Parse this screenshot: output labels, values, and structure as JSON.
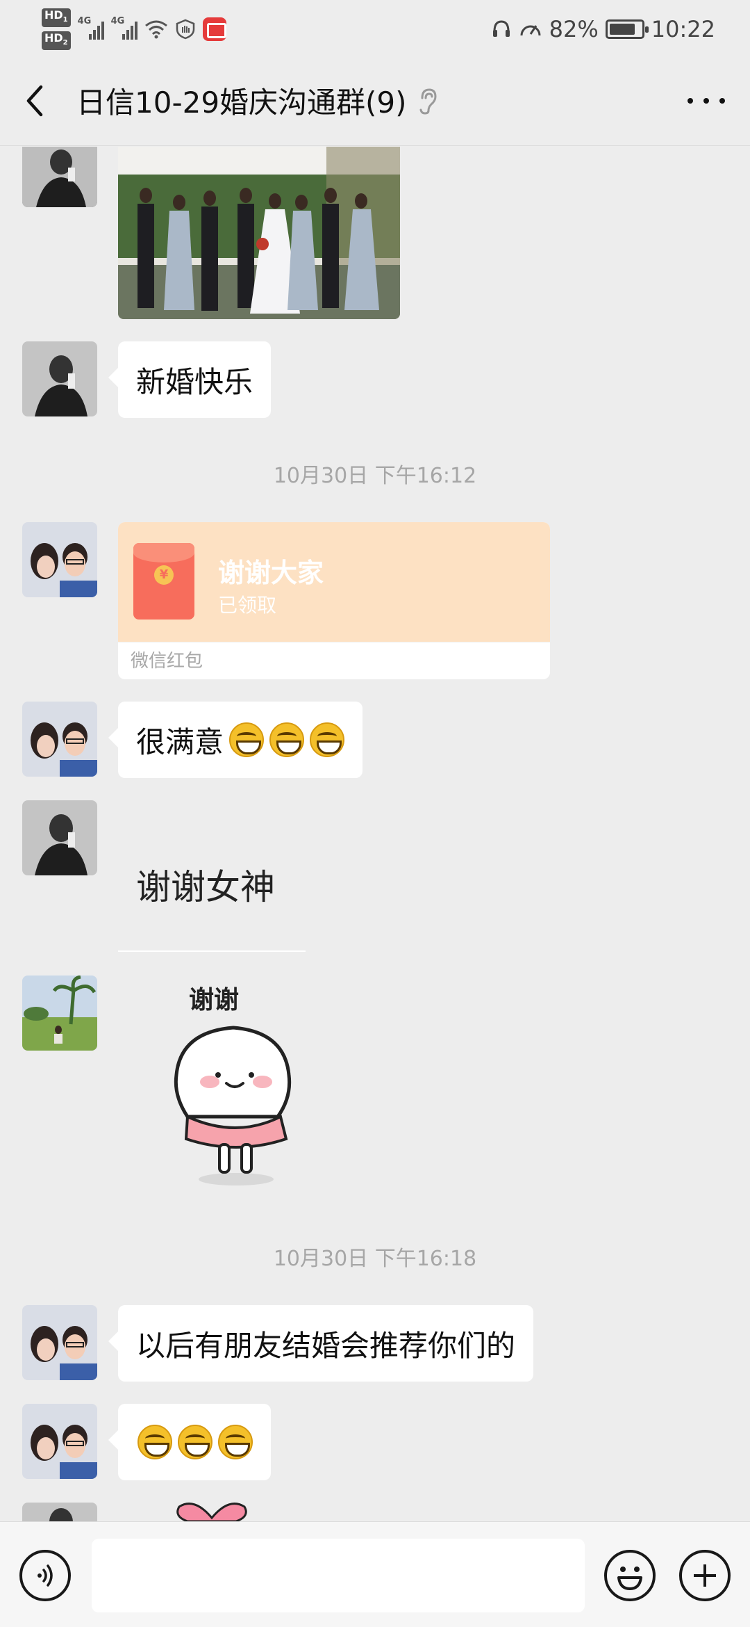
{
  "status_bar": {
    "hd1": "HD",
    "hd1_sub": "1",
    "hd2": "HD",
    "hd2_sub": "2",
    "net1": "4G",
    "net2": "4G",
    "battery_text": "82%",
    "battery_level": 0.82,
    "time": "10:22"
  },
  "header": {
    "title": "日信10-29婚庆沟通群(9)"
  },
  "chat": {
    "messages": [
      {
        "type": "image",
        "label": ""
      },
      {
        "type": "text",
        "text": "新婚快乐"
      },
      {
        "type": "time",
        "text": "10月30日 下午16:12"
      },
      {
        "type": "red_packet",
        "title": "谢谢大家",
        "status": "已领取",
        "footer": "微信红包"
      },
      {
        "type": "text",
        "text": "很满意"
      },
      {
        "type": "text_plain",
        "text": "谢谢女神"
      },
      {
        "type": "sticker",
        "text": "谢谢"
      },
      {
        "type": "time",
        "text": "10月30日 下午16:18"
      },
      {
        "type": "text",
        "text": "以后有朋友结婚会推荐你们的"
      },
      {
        "type": "emoji_only",
        "count": 3
      }
    ]
  },
  "input_bar": {
    "value": "",
    "placeholder": ""
  },
  "colors": {
    "background": "#ededed",
    "bubble": "#ffffff",
    "red_packet": "#fde1c3",
    "envelope": "#f76d5c"
  },
  "icons": [
    "back-icon",
    "ear-icon",
    "more-icon",
    "voice-icon",
    "emoji-icon",
    "plus-icon"
  ]
}
